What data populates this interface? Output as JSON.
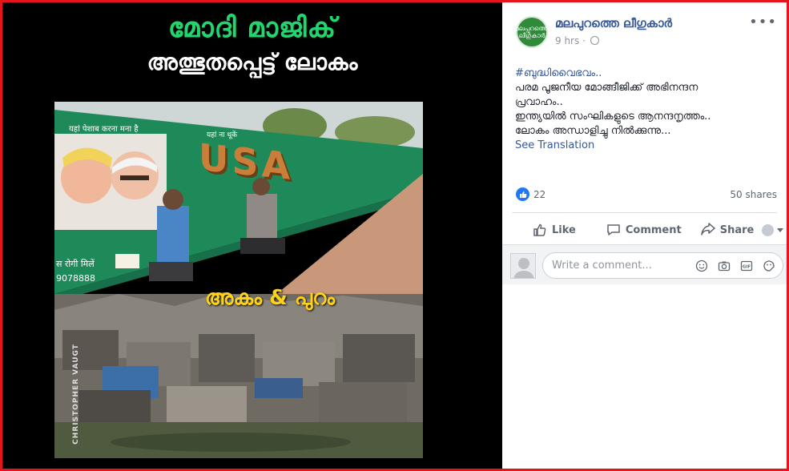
{
  "photo": {
    "title_line1": "മോദി മാജിക്",
    "title_line2": "അത്ഭുതപ്പെട്ട് ലോകം",
    "overlay_caption": "അകം & പുറം",
    "wall_text_1": "यहां पेशाब करना मना है",
    "wall_text_2": "यहां ना थूकें",
    "wall_text_usa": "USA",
    "wall_text_3": "स रोगी मिलें",
    "wall_text_4": "9078888",
    "watermark": "CHRISTOPHER VAUGT",
    "colors": {
      "title_green": "#22d66e",
      "overlay_yellow": "#ffd21a",
      "wall_green": "#1e8a5a"
    }
  },
  "post": {
    "page_name": "മലപുറത്തെ ലീഗുകാർ",
    "avatar_text": "മലപ്പുറത്തെ ലീഗുകാർ",
    "time": "9 hrs",
    "audience_icon": "globe-icon",
    "more_icon": "more-options-icon",
    "hashtag": "#ബുദ്ധിവൈഭവം..",
    "lines": [
      "പരമ പൂജനീയ മോങ്ങീജിക്ക് അഭിനന്ദന",
      "പ്രവാഹം..",
      "ഇന്ത്യയിൽ സംഘികളുടെ ആനന്ദനൃത്തം..",
      "ലോകം അന്ധാളിച്ചു നിൽക്കുന്നു..."
    ],
    "see_translation": "See Translation",
    "reaction_count": "22",
    "shares": "50 shares"
  },
  "actions": {
    "like": "Like",
    "comment": "Comment",
    "share": "Share"
  },
  "comment": {
    "placeholder": "Write a comment...",
    "icons": [
      "emoji-icon",
      "camera-icon",
      "gif-icon",
      "sticker-icon"
    ]
  },
  "colors": {
    "frame_border": "#e8141b",
    "link_blue": "#365899",
    "like_blue": "#2078f4"
  }
}
